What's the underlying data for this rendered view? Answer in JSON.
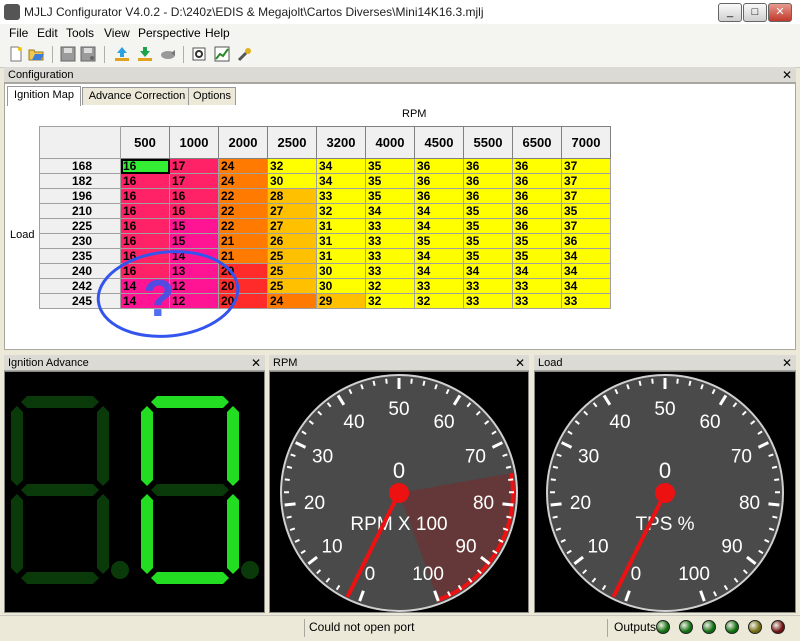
{
  "window": {
    "title": "MJLJ Configurator V4.0.2 - D:\\240z\\EDIS & Megajolt\\Cartos Diverses\\Mini14K16.3.mjlj"
  },
  "menu": [
    "File",
    "Edit",
    "Tools",
    "View",
    "Perspective",
    "Help"
  ],
  "toolbar_icons": [
    "new-file-icon",
    "open-folder-icon",
    "save-icon",
    "save-as-icon",
    "upload-icon",
    "download-icon",
    "burn-icon",
    "config-icon",
    "chart-icon",
    "wrench-icon"
  ],
  "config_panel": {
    "title": "Configuration",
    "tabs": [
      "Ignition Map",
      "Advance Correction",
      "Options"
    ],
    "rpm_label": "RPM",
    "load_label": "Load",
    "rpm_bins": [
      "500",
      "1000",
      "2000",
      "2500",
      "3200",
      "4000",
      "4500",
      "5500",
      "6500",
      "7000"
    ],
    "load_bins": [
      "168",
      "182",
      "196",
      "210",
      "225",
      "230",
      "235",
      "240",
      "242",
      "245"
    ],
    "map": [
      [
        "16",
        "17",
        "24",
        "32",
        "34",
        "35",
        "36",
        "36",
        "36",
        "37"
      ],
      [
        "16",
        "17",
        "24",
        "30",
        "34",
        "35",
        "36",
        "36",
        "36",
        "37"
      ],
      [
        "16",
        "16",
        "22",
        "28",
        "33",
        "35",
        "36",
        "36",
        "36",
        "37"
      ],
      [
        "16",
        "16",
        "22",
        "27",
        "32",
        "34",
        "34",
        "35",
        "36",
        "35"
      ],
      [
        "16",
        "15",
        "22",
        "27",
        "31",
        "33",
        "34",
        "35",
        "36",
        "37"
      ],
      [
        "16",
        "15",
        "21",
        "26",
        "31",
        "33",
        "35",
        "35",
        "35",
        "36"
      ],
      [
        "16",
        "14",
        "21",
        "25",
        "31",
        "33",
        "34",
        "35",
        "35",
        "34"
      ],
      [
        "16",
        "13",
        "20",
        "25",
        "30",
        "33",
        "34",
        "34",
        "34",
        "34"
      ],
      [
        "14",
        "12",
        "20",
        "25",
        "30",
        "32",
        "33",
        "33",
        "33",
        "34"
      ],
      [
        "14",
        "12",
        "20",
        "24",
        "29",
        "32",
        "32",
        "33",
        "33",
        "33"
      ]
    ],
    "annotation": "?"
  },
  "panels": {
    "advance": {
      "title": "Ignition Advance",
      "close": "✕"
    },
    "rpm": {
      "title": "RPM",
      "close": "✕",
      "center_value": "0",
      "unit_label": "RPM X 100"
    },
    "load": {
      "title": "Load",
      "close": "✕",
      "center_value": "0",
      "unit_label": "TPS %"
    }
  },
  "gauge_ticks": [
    "0",
    "10",
    "20",
    "30",
    "40",
    "50",
    "60",
    "70",
    "80",
    "90",
    "100"
  ],
  "status": {
    "message": "Could not open port",
    "outputs_label": "Outputs"
  },
  "output_leds": [
    "#0d6e0d",
    "#0d6e0d",
    "#0d6e0d",
    "#0d6e0d",
    "#6e6a10",
    "#6e1010"
  ],
  "colors": {
    "accent_selection": "#3355ee",
    "digit_on": "#22dd22",
    "digit_off": "#0a3a0a"
  }
}
